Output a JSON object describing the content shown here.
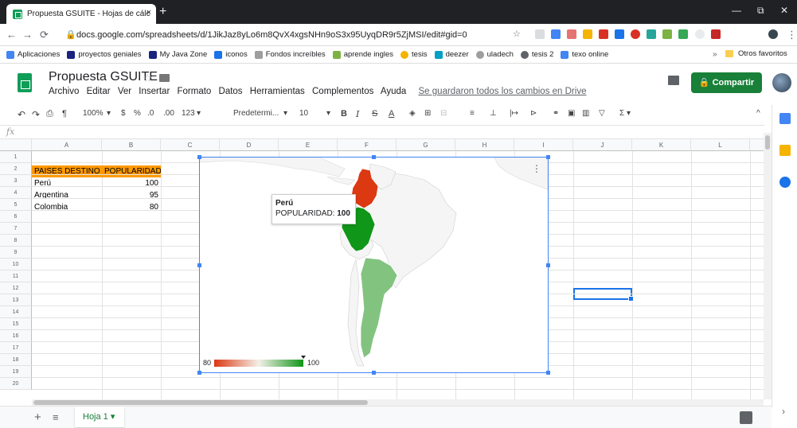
{
  "browser": {
    "tab_title": "Propuesta GSUITE - Hojas de cálc",
    "close": "×",
    "new_tab": "+",
    "url": "docs.google.com/spreadsheets/d/1JikJaz8yLo6m8QvX4xgsNHn9oS3x95UyqDR9r5ZjMSI/edit#gid=0",
    "window_controls": {
      "minimize": "—",
      "restore": "⧉",
      "close": "✕"
    },
    "bookmarks": [
      "Aplicaciones",
      "proyectos geniales",
      "My Java Zone",
      "iconos",
      "Fondos increíbles",
      "aprende ingles",
      "tesis",
      "deezer",
      "uladech",
      "tesis 2",
      "texo online"
    ],
    "other_bookmarks": "Otros favoritos",
    "overflow": "»"
  },
  "app": {
    "title": "Propuesta GSUITE",
    "menu": [
      "Archivo",
      "Editar",
      "Ver",
      "Insertar",
      "Formato",
      "Datos",
      "Herramientas",
      "Complementos",
      "Ayuda"
    ],
    "save_status": "Se guardaron todos los cambios en Drive",
    "share_label": "Compartir"
  },
  "toolbar": {
    "zoom": "100%",
    "currency": "$",
    "percent": "%",
    "dec_less": ".0",
    "dec_more": ".00",
    "format_more": "123",
    "font": "Predetermi...",
    "font_size": "10",
    "bold": "B",
    "italic": "I",
    "strike": "S",
    "text_color": "A",
    "sigma": "Σ"
  },
  "formula_bar": {
    "fx": "fx"
  },
  "grid": {
    "columns": [
      "A",
      "B",
      "C",
      "D",
      "E",
      "F",
      "G",
      "H",
      "I",
      "J",
      "K",
      "L"
    ],
    "rows": [
      "1",
      "2",
      "3",
      "4",
      "5",
      "6",
      "7",
      "8",
      "9",
      "10",
      "11",
      "12",
      "13",
      "14",
      "15",
      "16",
      "17",
      "18",
      "19",
      "20"
    ],
    "header_row": {
      "a": "PAISES DESTINO",
      "b": "POPULARIDAD"
    },
    "data": [
      {
        "a": "Perú",
        "b": "100"
      },
      {
        "a": "Argentina",
        "b": "95"
      },
      {
        "a": "Colombia",
        "b": "80"
      }
    ],
    "header_fill": "#ff9900"
  },
  "chart_data": {
    "type": "geo-map",
    "region": "South America",
    "series": [
      {
        "country": "Perú",
        "value": 100
      },
      {
        "country": "Argentina",
        "value": 95
      },
      {
        "country": "Colombia",
        "value": 80
      }
    ],
    "legend_min": "80",
    "legend_max": "100",
    "color_min": "#dc3912",
    "color_max": "#109618",
    "tooltip": {
      "country": "Perú",
      "label": "POPULARIDAD:",
      "value": "100"
    }
  },
  "sheet_tabs": {
    "active": "Hoja 1"
  }
}
